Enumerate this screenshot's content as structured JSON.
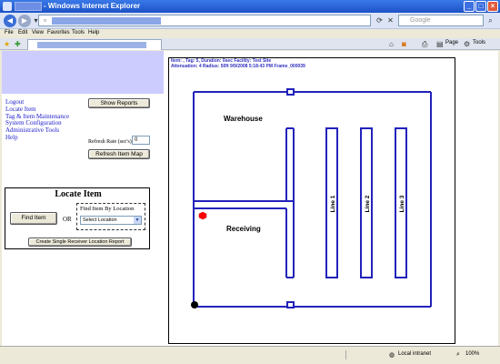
{
  "window": {
    "title": "- Windows Internet Explorer"
  },
  "addressbar": {
    "search_placeholder": "Google"
  },
  "menu": [
    "File",
    "Edit",
    "View",
    "Favorites",
    "Tools",
    "Help"
  ],
  "toolbar": {
    "page_label": "Page",
    "tools_label": "Tools"
  },
  "left_nav": {
    "links": [
      "Logout",
      "Locate Item",
      "Tag & Item Maintenance",
      "System Configuration",
      "Administrative Tools",
      "Help"
    ],
    "show_reports": "Show Reports",
    "refresh_rate_label": "Refresh Rate (sec's)",
    "refresh_rate_value": "0",
    "refresh_map": "Refresh Item Map"
  },
  "locate": {
    "title": "Locate Item",
    "find_item": "Find Item",
    "or": "OR",
    "find_by_location_label": "Find Item By Location",
    "select_value": "Select Location",
    "create_report": "Create Single Receiver Location Report"
  },
  "map": {
    "info_line1": "Item: ,     Tag: 5, Duration: 0sec     Facility: Test Site",
    "info_line2": "Attenuation: 4   Radius: 50ft   9/9/2008 5:18:43 PM Frame_000039",
    "areas": [
      "Warehouse",
      "Receiving"
    ],
    "lines": [
      "Line 1",
      "Line 2",
      "Line 3"
    ]
  },
  "statusbar": {
    "zone": "Local intranet",
    "zoom": "100%"
  },
  "colors": {
    "title_bar": "#1c52c7",
    "map_walls": "#2222bb",
    "item_marker": "#ff0000",
    "link": "#1a1acc",
    "header_band": "#ccccff"
  }
}
